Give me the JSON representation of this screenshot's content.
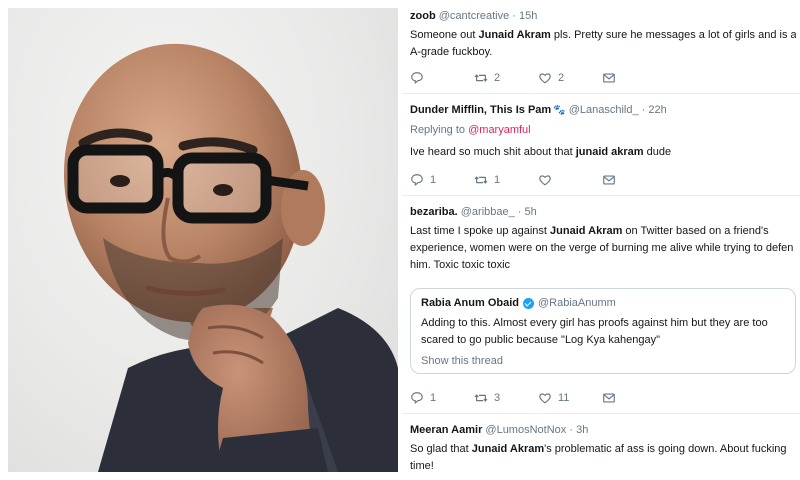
{
  "tweets": [
    {
      "name": "zoob",
      "handle": "@cantcreative",
      "time": "15h",
      "lines": [
        {
          "before": "Someone out ",
          "bold": "Junaid Akram",
          "after": " pls. Pretty sure he messages a lot of girls and is a"
        },
        {
          "before": "A-grade fuckboy.",
          "bold": "",
          "after": ""
        }
      ],
      "stats": {
        "replies": "",
        "retweets": "2",
        "likes": "2"
      }
    },
    {
      "name": "Dunder Mifflin, This Is Pam",
      "name_emoji": "🐾",
      "handle": "@Lanaschild_",
      "time": "22h",
      "replying_label": "Replying to",
      "replying_to": "@maryamful",
      "lines": [
        {
          "before": "Ive heard so much shit about that ",
          "bold": "junaid akram",
          "after": " dude"
        }
      ],
      "stats": {
        "replies": "1",
        "retweets": "1",
        "likes": ""
      }
    },
    {
      "name": "bezariba.",
      "handle": "@aribbae_",
      "time": "5h",
      "lines": [
        {
          "before": "Last time I spoke up against ",
          "bold": "Junaid Akram",
          "after": " on Twitter based on a friend's"
        },
        {
          "before": "experience, women were on the verge of burning me alive while trying to defen",
          "bold": "",
          "after": ""
        },
        {
          "before": "him. Toxic toxic toxic",
          "bold": "",
          "after": ""
        }
      ],
      "quote": {
        "name": "Rabia Anum Obaid",
        "handle": "@RabiaAnumm",
        "lines": [
          "Adding to this. Almost every girl has proofs against him but they are too",
          "scared to go public because \"Log Kya kahengay\""
        ],
        "show_thread": "Show this thread"
      },
      "stats": {
        "replies": "1",
        "retweets": "3",
        "likes": "11"
      }
    },
    {
      "name": "Meeran Aamir",
      "handle": "@LumosNotNox",
      "time": "3h",
      "lines": [
        {
          "before": "So glad that ",
          "bold": "Junaid Akram",
          "after": "'s problematic af ass is going down. About fucking"
        },
        {
          "before": "time!",
          "bold": "",
          "after": ""
        }
      ]
    }
  ],
  "separator": "·",
  "icons": {
    "reply": "reply-icon",
    "retweet": "retweet-icon",
    "like": "heart-icon",
    "dm": "envelope-icon",
    "verified": "verified-badge-icon"
  },
  "colors": {
    "text": "#14171a",
    "muted": "#657786",
    "mention": "#e0245e",
    "verified": "#1da1f2",
    "divider": "#e6ecf0"
  }
}
